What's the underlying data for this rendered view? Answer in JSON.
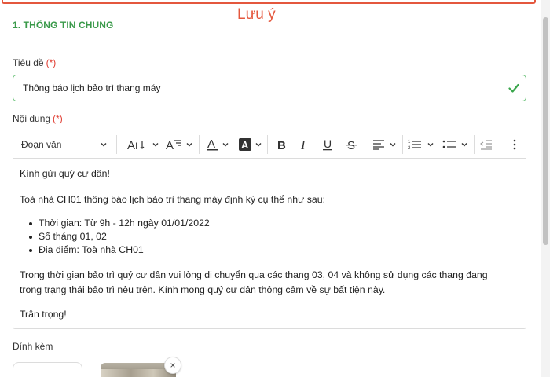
{
  "note": {
    "label": "Lưu ý"
  },
  "section": {
    "title": "1. THÔNG TIN CHUNG"
  },
  "title_field": {
    "label": "Tiêu đề",
    "required": "(*)",
    "value": "Thông báo lịch bảo trì thang máy"
  },
  "content_field": {
    "label": "Nội dung",
    "required": "(*)"
  },
  "toolbar": {
    "heading_select": "Đoạn văn"
  },
  "content": {
    "greeting": "Kính gửi quý cư dân!",
    "intro": "Toà nhà CH01 thông báo lịch bảo trì thang máy định kỳ cụ thể như sau:",
    "bullets": [
      "Thời gian: Từ 9h - 12h ngày 01/01/2022",
      "Số tháng 01, 02",
      "Địa điểm: Toà nhà CH01"
    ],
    "body_line1": "Trong thời gian bảo trì quý cư dân vui lòng di chuyển qua các thang 03, 04 và không sử dụng các thang đang",
    "body_line2": "trong trạng thái bảo trì nêu trên. Kính mong quý cư dân thông cảm về sự bất tiện này.",
    "closing": "Trân trọng!"
  },
  "attachments": {
    "label": "Đính kèm",
    "remove_symbol": "×"
  },
  "colors": {
    "accent": "#3a9a4a",
    "required": "#e03c31",
    "note": "#e4573d",
    "valid_border": "#6fc47d"
  },
  "icons": [
    "check-icon",
    "chevron-down-icon",
    "font-size-icon",
    "text-format-icon",
    "font-color-icon",
    "background-color-icon",
    "bold-icon",
    "italic-icon",
    "underline-icon",
    "strikethrough-icon",
    "align-icon",
    "numbered-list-icon",
    "bulleted-list-icon",
    "outdent-icon",
    "more-icon",
    "close-icon"
  ]
}
